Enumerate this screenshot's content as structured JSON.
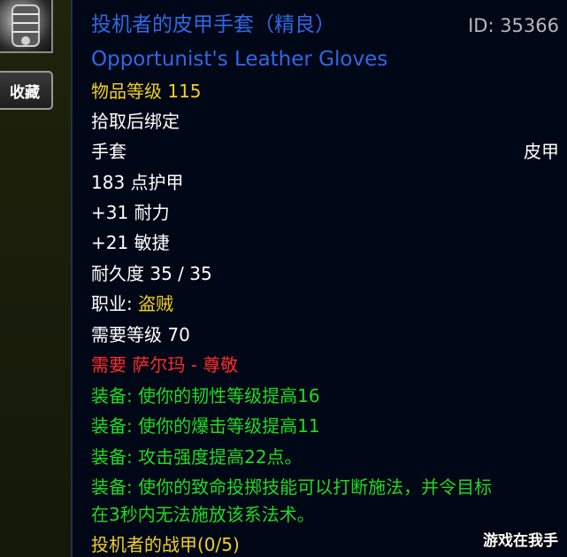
{
  "sidebar": {
    "item_icon": "armored-gauntlet-icon",
    "collect_label": "收藏"
  },
  "tooltip": {
    "title_cn": "投机者的皮甲手套（精良）",
    "id_text": "ID: 35366",
    "title_en": "Opportunist's Leather Gloves",
    "item_level": "物品等级 115",
    "bind": "拾取后绑定",
    "slot": "手套",
    "type": "皮甲",
    "armor": "183 点护甲",
    "stamina": "+31 耐力",
    "agility": "+21 敏捷",
    "durability": "耐久度 35 / 35",
    "class_label": "职业: ",
    "class_value": "盗贼",
    "required_level": "需要等级 70",
    "rep_req": "需要 萨尔玛 - 尊敬",
    "equip_1": "装备: 使你的韧性等级提高16",
    "equip_2": "装备: 使你的爆击等级提高11",
    "equip_3": "装备: 攻击强度提高22点。",
    "equip_4_line1": "装备: 使你的致命投掷技能可以打断施法，并令目标",
    "equip_4_line2": "在3秒内无法施放该系法术。",
    "set_name": "投机者的战甲(0/5)"
  },
  "watermark": "游戏在我手",
  "colors": {
    "rare_blue": "#2f68e8",
    "item_level_gold": "#f0d020",
    "requirement_red": "#ff2a2a",
    "equip_green": "#1edc1e",
    "background": "#000716"
  }
}
